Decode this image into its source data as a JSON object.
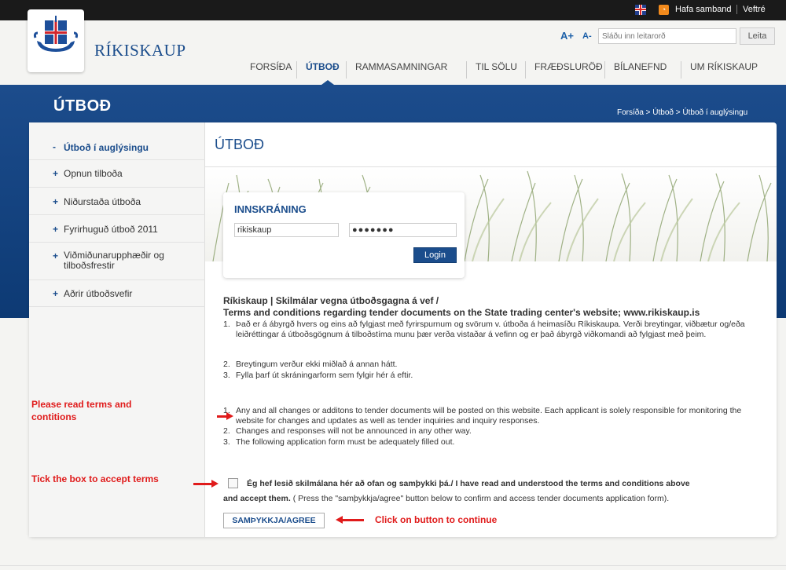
{
  "topbar": {
    "contact": "Hafa samband",
    "map": "Veftré"
  },
  "header": {
    "site_name": "RÍKISKAUP",
    "font_increase": "A+",
    "font_decrease": "A-",
    "search_placeholder": "Sláðu inn leitarorð",
    "search_button": "Leita"
  },
  "nav": {
    "items": [
      {
        "label": "FORSÍÐA"
      },
      {
        "label": "ÚTBOÐ"
      },
      {
        "label": "RAMMASAMNINGAR"
      },
      {
        "label": "TIL SÖLU"
      },
      {
        "label": "FRÆÐSLURÖÐ"
      },
      {
        "label": "BÍLANEFND"
      },
      {
        "label": "UM RÍKISKAUP"
      }
    ],
    "active": "ÚTBOÐ"
  },
  "band": {
    "title": "ÚTBOÐ",
    "breadcrumb": "Forsíða > Útboð > Útboð í auglýsingu"
  },
  "sidebar": {
    "items": [
      {
        "mark": "-",
        "label": "Útboð í auglýsingu"
      },
      {
        "mark": "+",
        "label": "Opnun tilboða"
      },
      {
        "mark": "+",
        "label": "Niðurstaða útboða"
      },
      {
        "mark": "+",
        "label": "Fyrirhuguð útboð 2011"
      },
      {
        "mark": "+",
        "label": "Viðmiðunarupphæðir og tilboðsfrestir"
      },
      {
        "mark": "+",
        "label": "Aðrir útboðsvefir"
      }
    ]
  },
  "main": {
    "title": "ÚTBOÐ"
  },
  "login": {
    "title": "INNSKRÁNING",
    "username": "rikiskaup",
    "password_mask": "●●●●●●●",
    "button": "Login"
  },
  "terms": {
    "heading1": "Ríkiskaup | Skilmálar vegna útboðsgagna á vef /",
    "heading2": "Terms and conditions regarding tender documents on the State trading center's website; www.rikiskaup.is",
    "is_items": [
      {
        "num": "1.",
        "text": "Það er á ábyrgð hvers og eins að fylgjast með fyrirspurnum og svörum v. útboða á heimasíðu Ríkiskaupa. Verði breytingar, viðbætur og/eða leiðréttingar á útboðsgögnum á tilboðstíma munu þær verða vistaðar á vefinn og er það ábyrgð viðkomandi að fylgjast með þeim."
      },
      {
        "num": "2.",
        "text": "Breytingum verður ekki miðlað á annan hátt."
      },
      {
        "num": "3.",
        "text": "Fylla þarf út skráningarform sem fylgir hér á eftir."
      }
    ],
    "en_items": [
      {
        "num": "1.",
        "text": "Any and all changes or additons to tender documents will be posted on this website. Each applicant is solely responsible for monitoring the website for changes and updates as well as tender inquiries and inquiry responses."
      },
      {
        "num": "2.",
        "text": "Changes and responses will not be announced in any other way."
      },
      {
        "num": "3.",
        "text": "The following application form must be adequately filled out."
      }
    ]
  },
  "accept": {
    "line1": "Ég hef lesið skilmálana hér að ofan og samþykki þá./ I have read and understood the terms and conditions above",
    "line2_bold": "and accept them.",
    "line2_rest": " ( Press the \"samþykkja/agree\" button below to confirm and access tender documents application form).",
    "button": "SAMÞYKKJA/AGREE"
  },
  "annotations": {
    "read_terms": "Please read terms and contitions",
    "tick_box": "Tick the box to accept terms",
    "click_button": "Click on button to continue"
  },
  "colors": {
    "brand_blue": "#1b4d8c",
    "annotation_red": "#e01b1b"
  }
}
